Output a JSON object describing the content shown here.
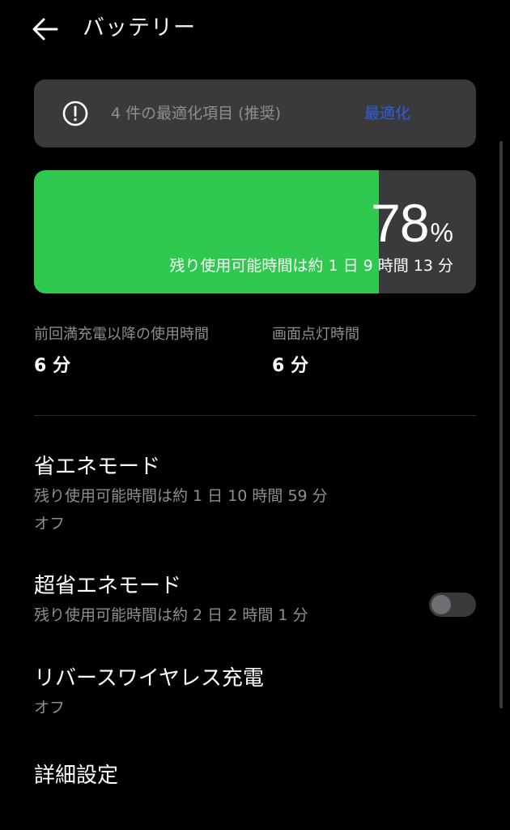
{
  "header": {
    "title": "バッテリー",
    "back_icon": "arrow-left-icon"
  },
  "recommendation": {
    "icon": "alert-circle-icon",
    "text": "4 件の最適化項目 (推奨)",
    "action_label": "最適化"
  },
  "battery": {
    "percent": 78,
    "percent_value": "78",
    "percent_unit": "%",
    "remaining": "残り使用可能時間は約 1 日 9 時間 13 分",
    "fill_color": "#30c94f"
  },
  "stats": {
    "since_charge": {
      "label": "前回満充電以降の使用時間",
      "value": "6 分"
    },
    "screen_on": {
      "label": "画面点灯時間",
      "value": "6 分"
    }
  },
  "settings": {
    "power_saving": {
      "title": "省エネモード",
      "subtitle": "残り使用可能時間は約 1 日 10 時間 59 分",
      "status": "オフ"
    },
    "super_power_saving": {
      "title": "超省エネモード",
      "subtitle": "残り使用可能時間は約 2 日 2 時間 1 分",
      "enabled": false
    },
    "reverse_wireless": {
      "title": "リバースワイヤレス充電",
      "status": "オフ"
    },
    "advanced": {
      "title": "詳細設定"
    }
  },
  "colors": {
    "background": "#000000",
    "card": "#3a3a3c",
    "accent_link": "#2f5fe0",
    "secondary_text": "#8e8e93"
  }
}
